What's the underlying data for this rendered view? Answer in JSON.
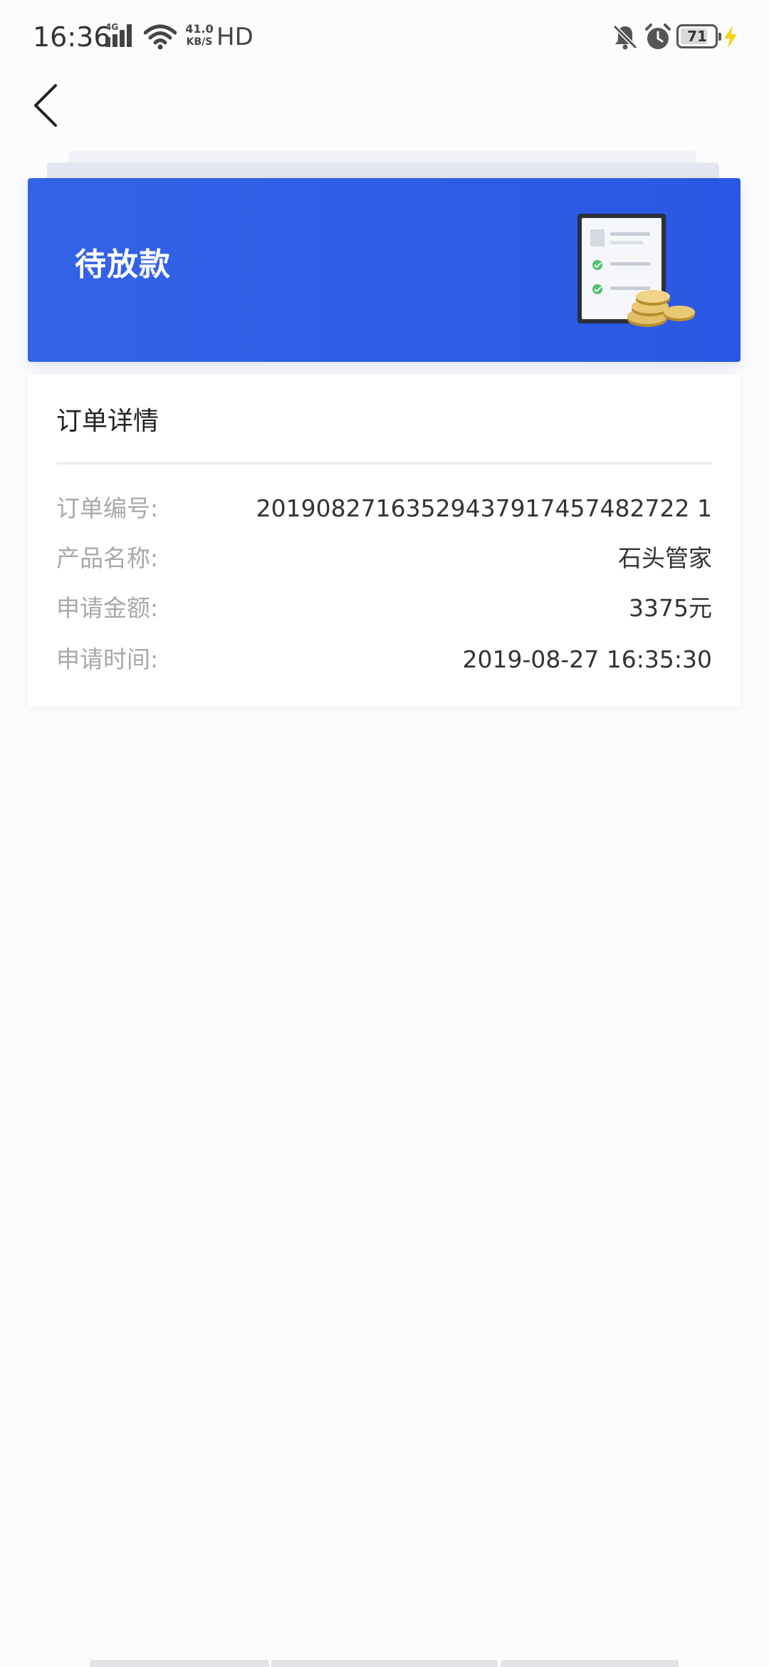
{
  "status_bar": {
    "time": "16:36",
    "network": "4G",
    "speed_value": "41.0",
    "speed_unit": "KB/S",
    "hd_label": "HD",
    "battery_level": "71",
    "icons": [
      "signal-icon",
      "wifi-icon",
      "mute-icon",
      "alarm-icon",
      "battery-icon",
      "charging-icon"
    ]
  },
  "nav": {
    "back_icon": "chevron-left-icon"
  },
  "banner": {
    "status_text": "待放款",
    "illustration": "document-coins-icon",
    "color": "#2f5de5"
  },
  "order_card": {
    "title": "订单详情",
    "rows": [
      {
        "label": "订单编号:",
        "value": "20190827163529437917457482722 1"
      },
      {
        "label": "产品名称:",
        "value": "石头管家"
      },
      {
        "label": "申请金额:",
        "value": "3375元"
      },
      {
        "label": "申请时间:",
        "value": "2019-08-27 16:35:30"
      }
    ]
  }
}
